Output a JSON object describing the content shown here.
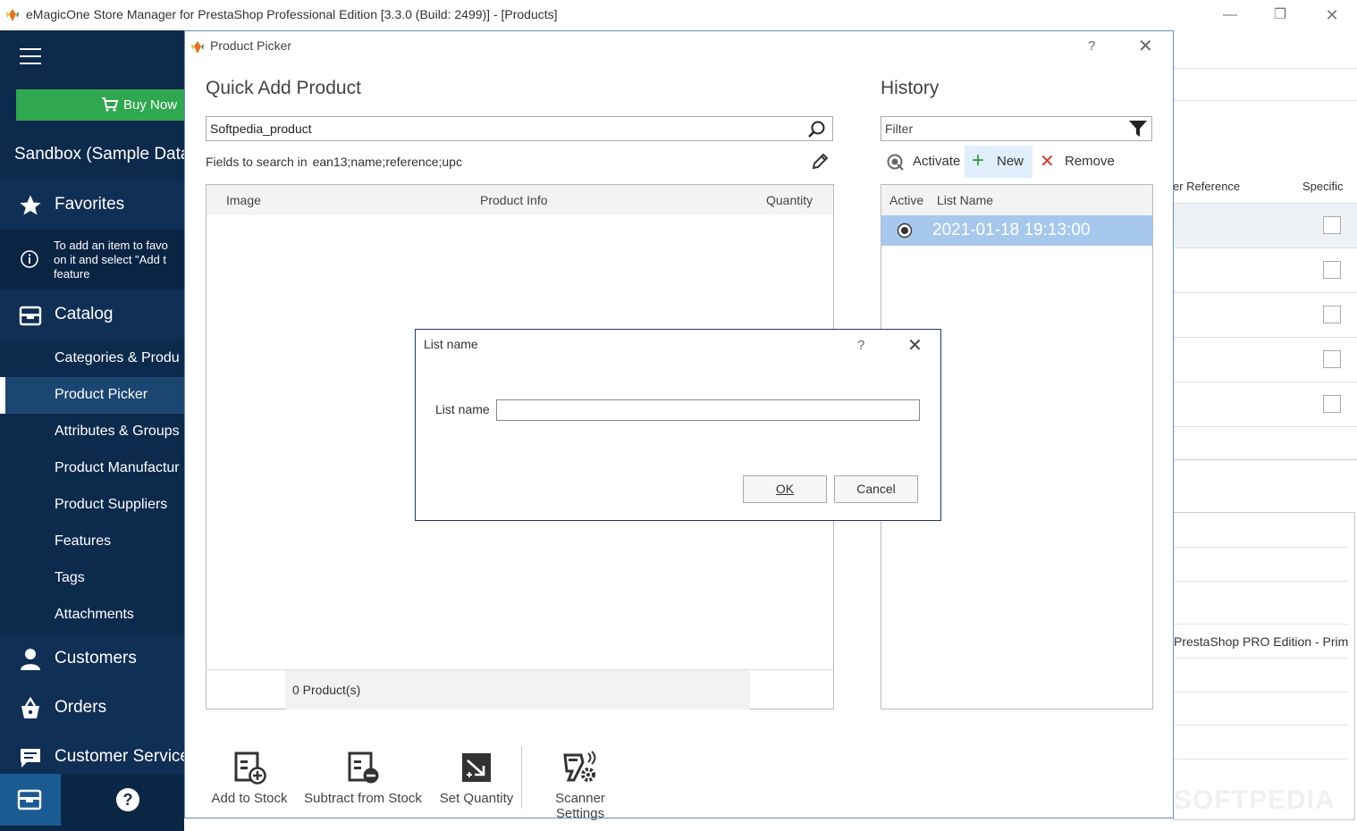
{
  "app": {
    "title": "eMagicOne Store Manager for PrestaShop Professional Edition [3.3.0 (Build: 2499)] - [Products]"
  },
  "sidebar": {
    "buy_now": "Buy Now",
    "store_name": "Sandbox (Sample Data",
    "favorites": "Favorites",
    "favorites_hint": "To add an item to favo\non it and select \"Add t\nfeature",
    "catalog": "Catalog",
    "catalog_items": [
      {
        "label": "Categories & Produ"
      },
      {
        "label": "Product Picker"
      },
      {
        "label": "Attributes & Groups"
      },
      {
        "label": "Product Manufactur"
      },
      {
        "label": "Product Suppliers"
      },
      {
        "label": "Features"
      },
      {
        "label": "Tags"
      },
      {
        "label": "Attachments"
      }
    ],
    "customers": "Customers",
    "orders": "Orders",
    "customer_service": "Customer Service",
    "help_label": "?"
  },
  "background": {
    "col_reference": "er Reference",
    "col_specific": "Specific",
    "footer_text": "PrestaShop PRO Edition - Prim",
    "watermark": "SOFTPEDIA"
  },
  "dialog": {
    "title": "Product Picker",
    "help": "?",
    "quick_add_title": "Quick Add Product",
    "search_value": "Softpedia_product",
    "fields_label": "Fields to search in",
    "fields_value": "ean13;name;reference;upc",
    "grid_columns": [
      "Image",
      "Product Info",
      "Quantity"
    ],
    "product_count": "0 Product(s)",
    "history_title": "History",
    "filter_placeholder": "Filter",
    "activate": "Activate",
    "new": "New",
    "remove": "Remove",
    "history_columns": [
      "Active",
      "List Name"
    ],
    "history_rows": [
      {
        "name": "2021-01-18 19:13:00",
        "active": true
      }
    ],
    "toolbar": {
      "add_to_stock": "Add to Stock",
      "subtract_from_stock": "Subtract from Stock",
      "set_quantity": "Set Quantity",
      "scanner_settings": "Scanner Settings"
    }
  },
  "modal": {
    "title": "List name",
    "help": "?",
    "label": "List name",
    "value": "",
    "ok": "OK",
    "cancel": "Cancel"
  },
  "colors": {
    "sidebar_bg": "#0c2a4c",
    "buy_now": "#2fa84f",
    "selection": "#a6c8ec",
    "accent": "#1b5a93"
  }
}
